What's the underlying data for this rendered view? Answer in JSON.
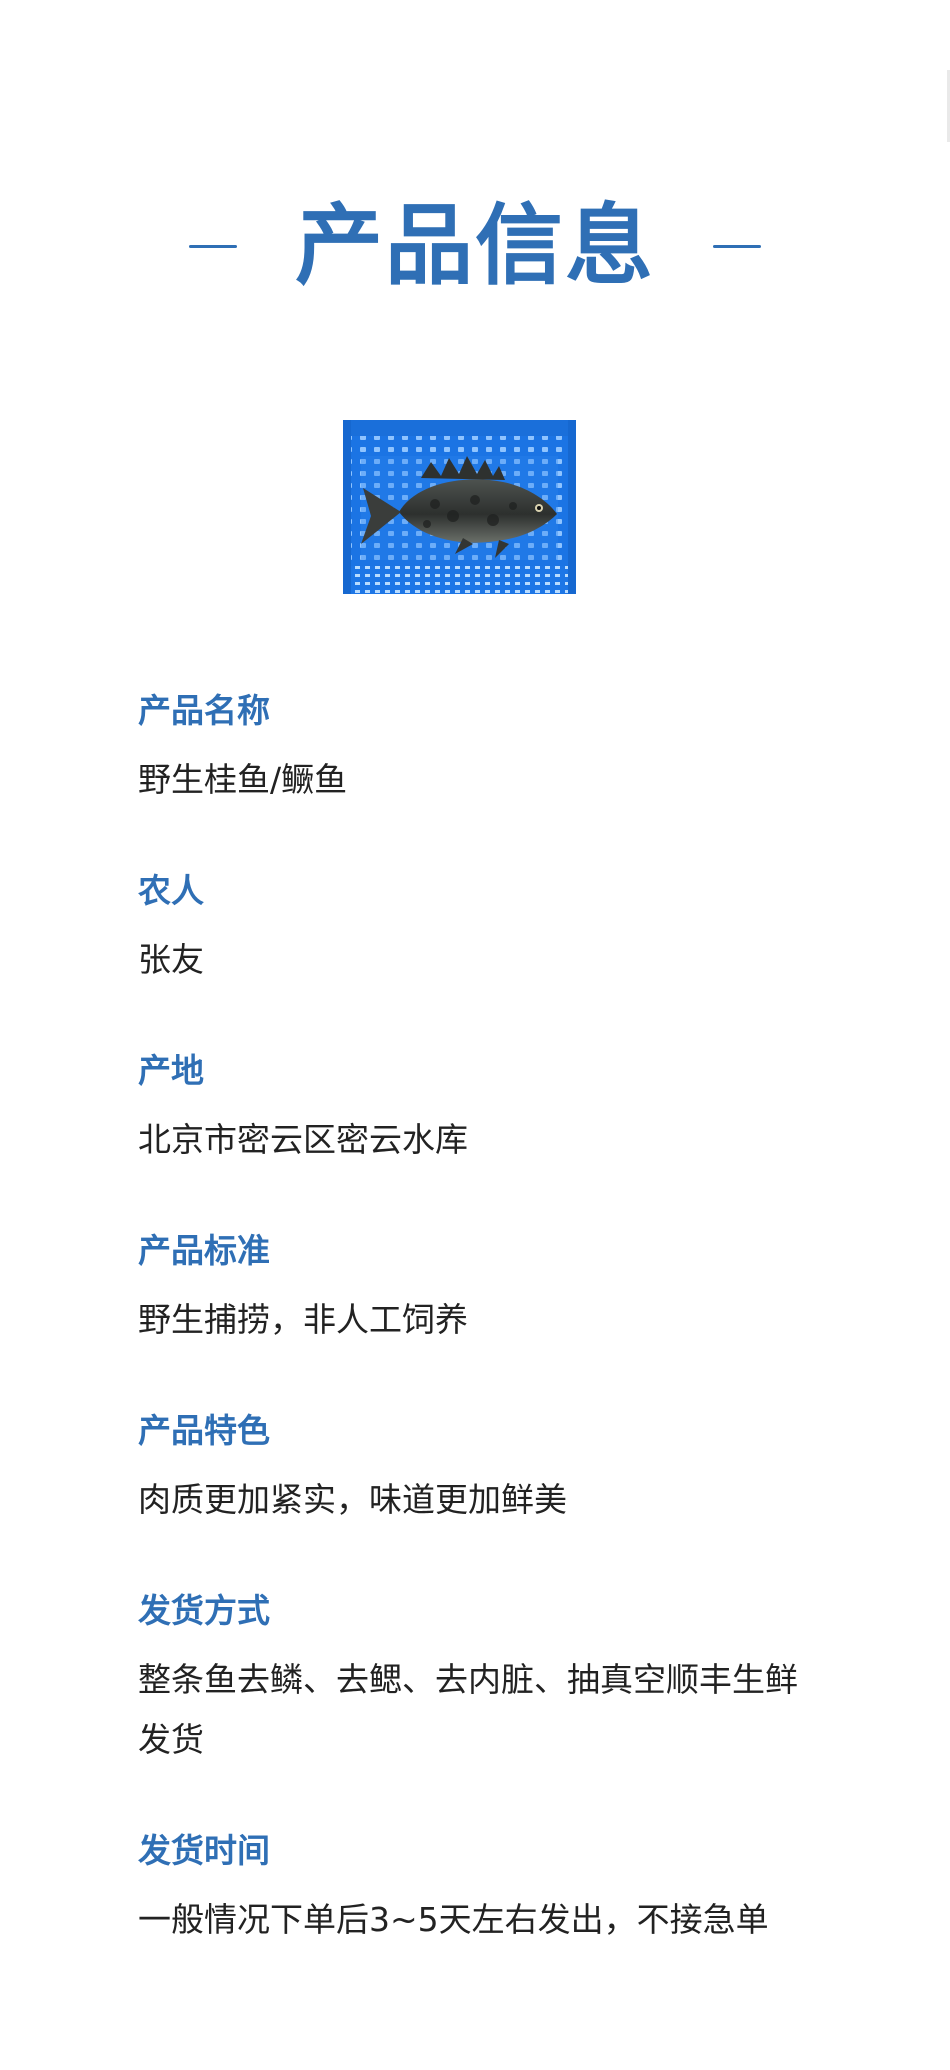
{
  "page": {
    "title": "产品信息"
  },
  "product_image": {
    "icon": "fish-in-basket-photo"
  },
  "details": [
    {
      "label": "产品名称",
      "value": "野生桂鱼/鳜鱼"
    },
    {
      "label": "农人",
      "value": "张友"
    },
    {
      "label": "产地",
      "value": "北京市密云区密云水库"
    },
    {
      "label": "产品标准",
      "value": "野生捕捞，非人工饲养"
    },
    {
      "label": "产品特色",
      "value": "肉质更加紧实，味道更加鲜美"
    },
    {
      "label": "发货方式",
      "value": "整条鱼去鳞、去鳃、去内脏、抽真空顺丰生鲜发货"
    },
    {
      "label": "发货时间",
      "value": "一般情况下单后3~5天左右发出，不接急单"
    }
  ],
  "colors": {
    "accent": "#2f6fb5",
    "text": "#222222",
    "background": "#ffffff"
  }
}
